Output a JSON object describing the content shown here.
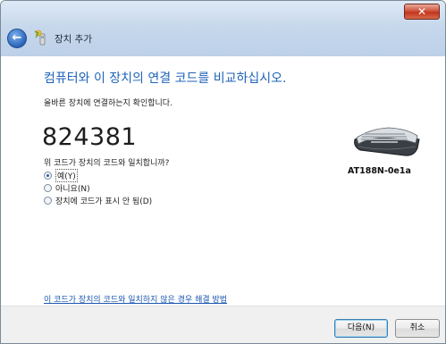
{
  "window": {
    "title": "장치 추가",
    "close_glyph": "✕"
  },
  "heading": "컴퓨터와 이 장치의 연결 코드를 비교하십시오.",
  "subtext": "올바른 장치에 연결하는지 확인합니다.",
  "pairing_code": "824381",
  "question": "위 코드가 장치의 코드와 일치합니까?",
  "options": [
    {
      "label": "예(Y)",
      "checked": true
    },
    {
      "label": "아니요(N)",
      "checked": false
    },
    {
      "label": "장치에 코드가 표시 안 됨(D)",
      "checked": false
    }
  ],
  "device": {
    "name": "AT188N-0e1a",
    "icon": "keyboard-icon"
  },
  "help_link": "이 코드가 장치의 코드와 일치하지 않은 경우 해결 방법",
  "buttons": {
    "next": "다음(N)",
    "cancel": "취소"
  },
  "colors": {
    "heading": "#1f63b8",
    "link": "#1a56b0",
    "close": "#c2351f"
  }
}
